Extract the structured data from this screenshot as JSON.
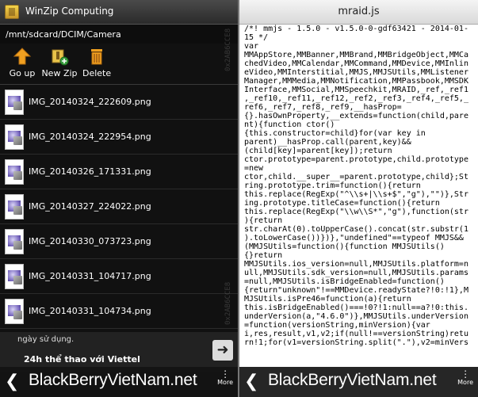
{
  "left": {
    "title": "WinZip Computing",
    "path": "/mnt/sdcard/DCIM/Camera",
    "toolbar": {
      "go_up": "Go up",
      "new_zip": "New Zip",
      "delete": "Delete"
    },
    "files": [
      "IMG_20140324_222609.png",
      "IMG_20140324_222954.png",
      "IMG_20140326_171331.png",
      "IMG_20140327_224022.png",
      "IMG_20140330_073723.png",
      "IMG_20140331_104717.png",
      "IMG_20140331_104734.png"
    ],
    "watermark": "0x2AB6CCE8",
    "ad": {
      "line1": "ngày sử dụng.",
      "line2": "24h thể thao với Viettel"
    }
  },
  "right": {
    "title": "mraid.js",
    "code_lines": [
      "/*! mmjs - 1.5.0 - v1.5.0-0-gdf63421 - 2014-01-",
      "15 */",
      "var",
      "MMAppStore,MMBanner,MMBrand,MMBridgeObject,MMCa",
      "chedVideo,MMCalendar,MMCommand,MMDevice,MMInlin",
      "eVideo,MMInterstitial,MMJS,MMJSUtils,MMListener",
      "Manager,MMMedia,MMNotification,MMPassbook,MMSDK",
      "Interface,MMSocial,MMSpeechkit,MRAID,_ref,_ref1",
      ",_ref10,_ref11,_ref12,_ref2,_ref3,_ref4,_ref5,_",
      "ref6,_ref7,_ref8,_ref9,__hasProp=",
      "{}.hasOwnProperty,__extends=function(child,pare",
      "nt){function ctor()",
      "{this.constructor=child}for(var key in",
      "parent)__hasProp.call(parent,key)&&",
      "(child[key]=parent[key]);return",
      "ctor.prototype=parent.prototype,child.prototype",
      "=new",
      "ctor,child.__super__=parent.prototype,child};St",
      "ring.prototype.trim=function(){return",
      "this.replace(RegExp(\"^\\\\s+|\\\\s+$\",\"g\"),\"\")},Str",
      "ing.prototype.titleCase=function(){return",
      "this.replace(RegExp(\"\\\\w\\\\S*\",\"g\"),function(str",
      "){return",
      "str.charAt(0).toUpperCase().concat(str.substr(1",
      ").toLowerCase())})},\"undefined\"==typeof MMJS&&",
      "(MMJSUtils=function(){function MMJSUtils()",
      "{}return",
      "MMJSUtils.ios_version=null,MMJSUtils.platform=n",
      "ull,MMJSUtils.sdk_version=null,MMJSUtils.params",
      "=null,MMJSUtils.isBridgeEnabled=function()",
      "{return\"unknown\"!==MMDevice.readyState?!0:!1},M",
      "MJSUtils.isPre46=function(a){return",
      "this.isBridgeEnabled()===!0?!1:null==a?!0:this.",
      "underVersion(a,\"4.6.0\")},MMJSUtils.underVersion",
      "=function(versionString,minVersion){var",
      "i,res,result,v1,v2;if(null!==versionString)retu",
      "rn!1;for(v1=versionString.split(\".\"),v2=minVers"
    ]
  },
  "bottom": {
    "brand": "BlackBerryVietNam.net",
    "more": "More"
  }
}
